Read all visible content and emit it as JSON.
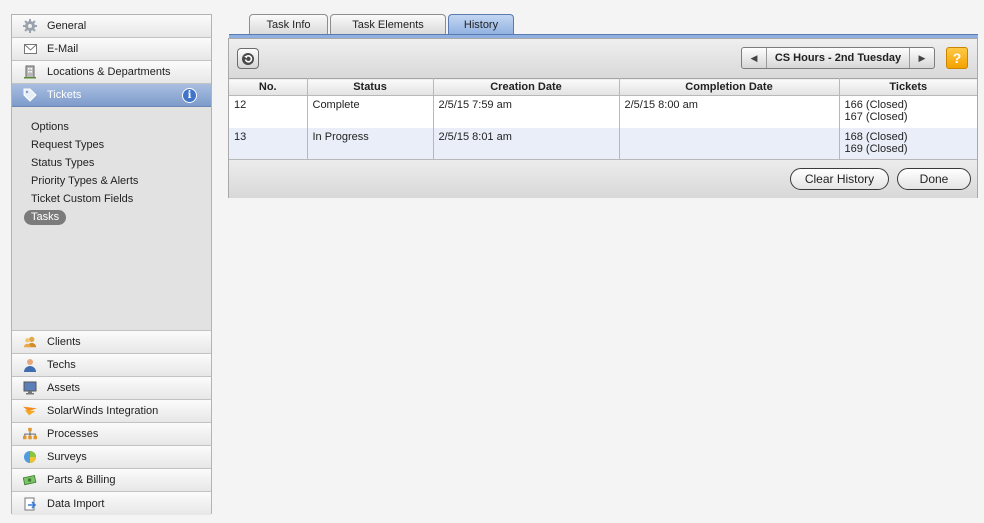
{
  "sidebar": {
    "top_items": [
      {
        "label": "General",
        "icon": "gear-icon"
      },
      {
        "label": "E-Mail",
        "icon": "envelope-icon"
      },
      {
        "label": "Locations & Departments",
        "icon": "building-icon"
      },
      {
        "label": "Tickets",
        "icon": "tag-icon",
        "selected": true
      }
    ],
    "sub_items": [
      "Options",
      "Request Types",
      "Status Types",
      "Priority Types & Alerts",
      "Ticket Custom Fields",
      "Tasks"
    ],
    "active_sub_item": "Tasks",
    "bottom_items": [
      {
        "label": "Clients",
        "icon": "clients-icon"
      },
      {
        "label": "Techs",
        "icon": "tech-person-icon"
      },
      {
        "label": "Assets",
        "icon": "monitor-icon"
      },
      {
        "label": "SolarWinds Integration",
        "icon": "solarwinds-icon"
      },
      {
        "label": "Processes",
        "icon": "org-chart-icon"
      },
      {
        "label": "Surveys",
        "icon": "pie-chart-icon"
      },
      {
        "label": "Parts & Billing",
        "icon": "money-icon"
      },
      {
        "label": "Data Import",
        "icon": "import-icon"
      }
    ],
    "info_badge": "i"
  },
  "tabs": [
    {
      "label": "Task Info",
      "active": false
    },
    {
      "label": "Task Elements",
      "active": false
    },
    {
      "label": "History",
      "active": true
    }
  ],
  "toolbar": {
    "task_name": "CS Hours - 2nd Tuesday",
    "help_label": "?"
  },
  "history_table": {
    "columns": [
      "No.",
      "Status",
      "Creation Date",
      "Completion Date",
      "Tickets"
    ],
    "rows": [
      {
        "no": "12",
        "status": "Complete",
        "creation": "2/5/15 7:59 am",
        "completion": "2/5/15 8:00 am",
        "tickets": [
          "166 (Closed)",
          "167 (Closed)"
        ]
      },
      {
        "no": "13",
        "status": "In Progress",
        "creation": "2/5/15 8:01 am",
        "completion": "",
        "tickets": [
          "168 (Closed)",
          "169 (Closed)"
        ]
      }
    ]
  },
  "footer": {
    "clear_history_label": "Clear History",
    "done_label": "Done"
  },
  "colors": {
    "selected_nav": "#7d9bcb",
    "active_tab": "#8fb0e0",
    "alt_row": "#e9eef9",
    "help_button": "#f3a200"
  }
}
